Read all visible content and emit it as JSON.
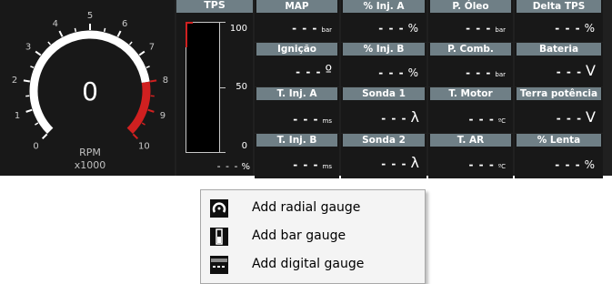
{
  "rpm_gauge": {
    "value": "0",
    "label": "RPM",
    "multiplier": "x1000",
    "scale_labels": [
      "0",
      "1",
      "2",
      "3",
      "4",
      "5",
      "6",
      "7",
      "8",
      "9",
      "10"
    ],
    "max": 10,
    "red_from": 8,
    "needle_value": 0
  },
  "tps": {
    "title": "TPS",
    "scale_labels": [
      "100",
      "50",
      "0"
    ],
    "value": "- - -",
    "unit": "%",
    "level_percent": 0
  },
  "cells": [
    {
      "title": "MAP",
      "value": "- - -",
      "unit": "bar",
      "unit_size": "small"
    },
    {
      "title": "% Inj. A",
      "value": "- - -",
      "unit": "%",
      "unit_size": "normal"
    },
    {
      "title": "P. Óleo",
      "value": "- - -",
      "unit": "bar",
      "unit_size": "small"
    },
    {
      "title": "Delta TPS",
      "value": "- - -",
      "unit": "%",
      "unit_size": "normal"
    },
    {
      "title": "Ignição",
      "value": "- - -",
      "unit": "º",
      "unit_size": "big"
    },
    {
      "title": "% Inj. B",
      "value": "- - -",
      "unit": "%",
      "unit_size": "normal"
    },
    {
      "title": "P. Comb.",
      "value": "- - -",
      "unit": "bar",
      "unit_size": "small"
    },
    {
      "title": "Bateria",
      "value": "- - -",
      "unit": "V",
      "unit_size": "big"
    },
    {
      "title": "T. Inj. A",
      "value": "- - -",
      "unit": "ms",
      "unit_size": "small"
    },
    {
      "title": "Sonda 1",
      "value": "- - -",
      "unit": "λ",
      "unit_size": "big"
    },
    {
      "title": "T. Motor",
      "value": "- - -",
      "unit": "ºC",
      "unit_size": "small"
    },
    {
      "title": "Terra potência",
      "value": "- - -",
      "unit": "V",
      "unit_size": "big"
    },
    {
      "title": "T. Inj. B",
      "value": "- - -",
      "unit": "ms",
      "unit_size": "small"
    },
    {
      "title": "Sonda 2",
      "value": "- - -",
      "unit": "λ",
      "unit_size": "big"
    },
    {
      "title": "T. AR",
      "value": "- - -",
      "unit": "ºC",
      "unit_size": "small"
    },
    {
      "title": "% Lenta",
      "value": "- - -",
      "unit": "%",
      "unit_size": "normal"
    }
  ],
  "context_menu": {
    "items": [
      {
        "label": "Add radial gauge",
        "icon": "radial-gauge-icon"
      },
      {
        "label": "Add bar gauge",
        "icon": "bar-gauge-icon"
      },
      {
        "label": "Add digital gauge",
        "icon": "digital-gauge-icon"
      }
    ]
  },
  "colors": {
    "background": "#202020",
    "panel": "#181818",
    "header": "#6f7f86",
    "redline": "#d02020",
    "text": "#ffffff"
  }
}
